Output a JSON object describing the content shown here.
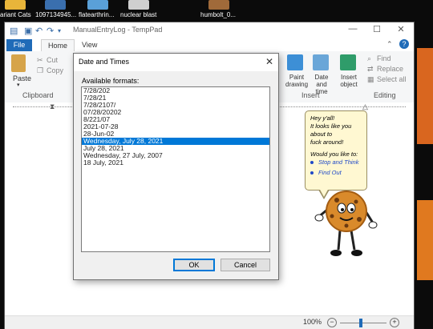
{
  "desktop": {
    "icons": [
      {
        "label": "ariant Cats",
        "color": "#e8b53a"
      },
      {
        "label": "1097134945...",
        "color": "#3a6fae"
      },
      {
        "label": "flatearthrin...",
        "color": "#5aa0d8"
      },
      {
        "label": "nuclear blast",
        "color": "#cfcfcf"
      },
      {
        "label": "humbolt_0...",
        "color": "#a06a3a"
      }
    ]
  },
  "window": {
    "title": "ManualEntryLog - TempPad",
    "minimize": "—",
    "maximize": "☐",
    "close": "✕"
  },
  "tabs": {
    "file": "File",
    "home": "Home",
    "view": "View"
  },
  "ribbon": {
    "clipboard": {
      "group_label": "Clipboard",
      "paste": "Paste",
      "cut": "Cut",
      "copy": "Copy"
    },
    "insert": {
      "group_label": "Insert",
      "paint_drawing": "Paint drawing",
      "date_and_time": "Date and time",
      "insert_object": "Insert object"
    },
    "editing": {
      "group_label": "Editing",
      "find": "Find",
      "replace": "Replace",
      "select_all": "Select all"
    }
  },
  "statusbar": {
    "zoom": "100%",
    "minus": "−",
    "plus": "+"
  },
  "dialog": {
    "title": "Date and Times",
    "close": "✕",
    "formats_label": "Available formats:",
    "formats": [
      "7/28/202",
      "7/28/21",
      "7/28/2107/",
      "07/28/20202",
      "8/221/07",
      "2021-07-28",
      "28-Jun-02",
      "Wednesday, July 28, 2021",
      "July 28, 2021",
      "Wednesday, 27 July, 2007",
      "18 July, 2021"
    ],
    "selected_index": 7,
    "ok": "OK",
    "cancel": "Cancel"
  },
  "assistant": {
    "lines": [
      "Hey y'all!",
      "It looks like you",
      "about to",
      "fuck around!"
    ],
    "question": "Would you like to:",
    "options": [
      "Stop and Think",
      "Find Out"
    ]
  }
}
